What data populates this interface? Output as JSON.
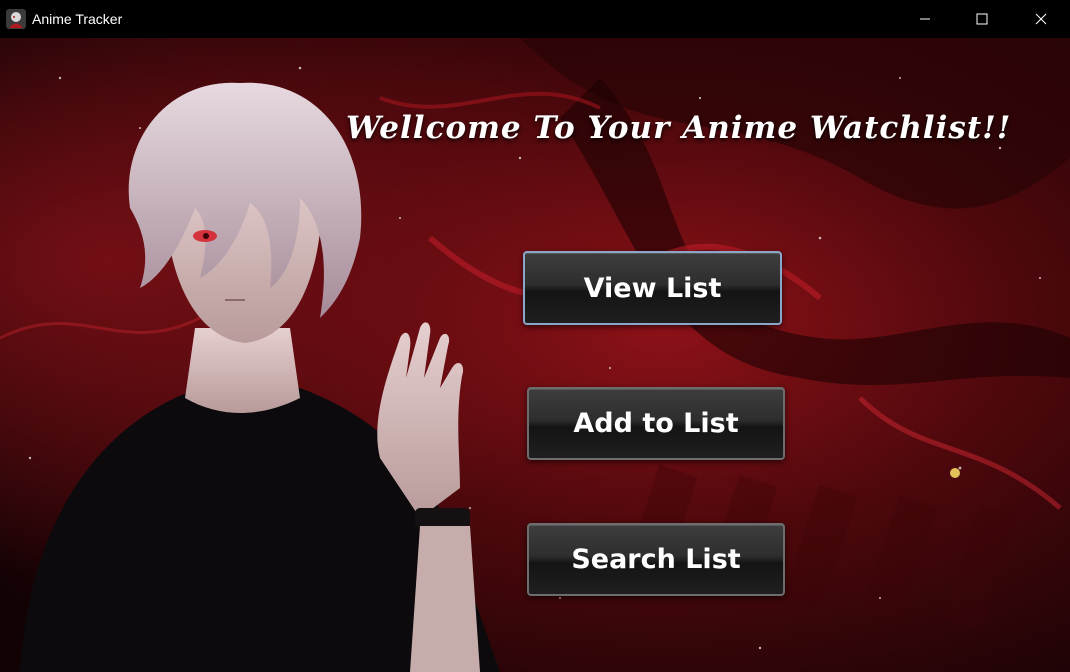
{
  "window": {
    "title": "Anime Tracker"
  },
  "title_bar_icons": {
    "app": "app-logo-icon",
    "minimize": "minimize-icon",
    "maximize": "maximize-icon",
    "close": "close-icon"
  },
  "main": {
    "headline": "Wellcome To Your Anime Watchlist!!",
    "buttons": {
      "view": "View List",
      "add": "Add to List",
      "search": "Search List"
    },
    "background_art": "anime-character-red-background"
  },
  "colors": {
    "titlebar_bg": "#000000",
    "title_text": "#ffffff",
    "button_bg": "#2a2a2a",
    "button_border": "#6d6d6d",
    "button_focus_border": "#8aa6c9",
    "background_red": "#7a0d12"
  }
}
